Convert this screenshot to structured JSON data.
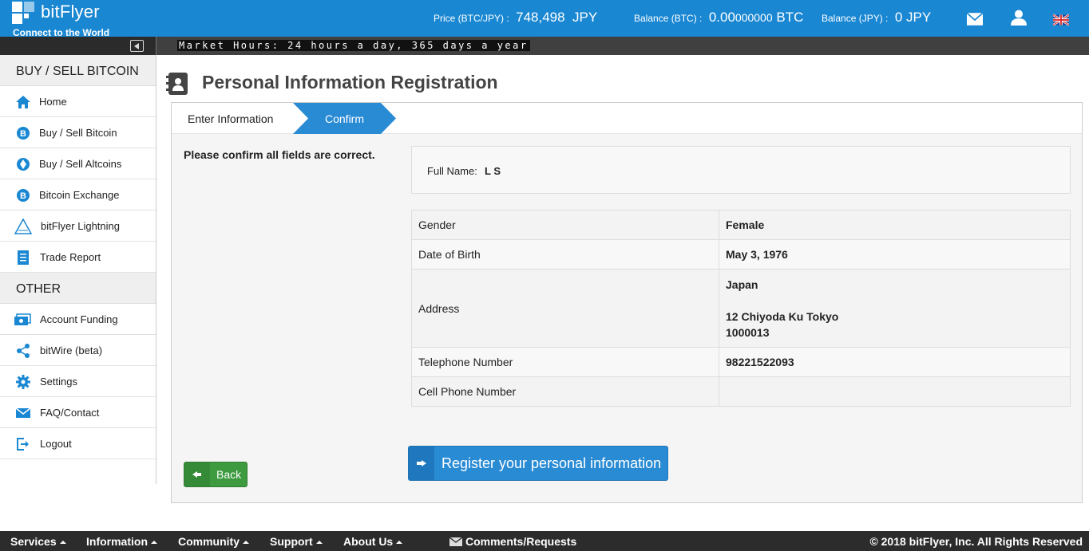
{
  "header": {
    "brand": "bitFlyer",
    "tagline": "Connect to the World",
    "price_label": "Price (BTC/JPY) :",
    "price_value": "748,498  JPY",
    "balance_btc_label": "Balance (BTC) :",
    "balance_btc_value_main": "0.00",
    "balance_btc_value_small": "000000",
    "balance_btc_unit": " BTC",
    "balance_jpy_label": "Balance (JPY) :",
    "balance_jpy_value": "0 JPY"
  },
  "market": {
    "hours_text": "Market Hours: 24 hours a day, 365 days a year"
  },
  "sidebar": {
    "section_buy_sell": "BUY / SELL BITCOIN",
    "section_other": "OTHER",
    "items_main": [
      {
        "label": "Home",
        "icon": "home-icon"
      },
      {
        "label": "Buy / Sell Bitcoin",
        "icon": "bitcoin-icon"
      },
      {
        "label": "Buy / Sell Altcoins",
        "icon": "ethereum-icon"
      },
      {
        "label": "Bitcoin Exchange",
        "icon": "bitcoin-icon"
      },
      {
        "label": "bitFlyer Lightning",
        "icon": "lightning-icon"
      },
      {
        "label": "Trade Report",
        "icon": "report-icon"
      }
    ],
    "items_other": [
      {
        "label": "Account Funding",
        "icon": "funding-icon"
      },
      {
        "label": "bitWire (beta)",
        "icon": "share-icon"
      },
      {
        "label": "Settings",
        "icon": "gear-icon"
      },
      {
        "label": "FAQ/Contact",
        "icon": "mail-icon"
      },
      {
        "label": "Logout",
        "icon": "logout-icon"
      }
    ]
  },
  "page": {
    "title": "Personal Information Registration",
    "step1": "Enter Information",
    "step2": "Confirm",
    "confirm_message": "Please confirm all fields are correct.",
    "full_name_label": "Full Name:",
    "full_name_value": "L S",
    "fields": {
      "gender_label": "Gender",
      "gender_value": "Female",
      "dob_label": "Date of Birth",
      "dob_value": "May 3, 1976",
      "address_label": "Address",
      "address_country": "Japan",
      "address_street": "12 Chiyoda Ku Tokyo",
      "address_postcode": "1000013",
      "telephone_label": "Telephone Number",
      "telephone_value": "98221522093",
      "cell_label": "Cell Phone Number",
      "cell_value": ""
    },
    "back_label": "Back",
    "register_label": "Register your personal information"
  },
  "footer": {
    "services": "Services",
    "information": "Information",
    "community": "Community",
    "support": "Support",
    "about": "About Us",
    "comments": "Comments/Requests",
    "copyright": "© 2018 bitFlyer, Inc. All Rights Reserved"
  },
  "colors": {
    "brand_blue": "#1a87d2",
    "step_active": "#2a8bd5",
    "back_green": "#3d9a3f"
  }
}
